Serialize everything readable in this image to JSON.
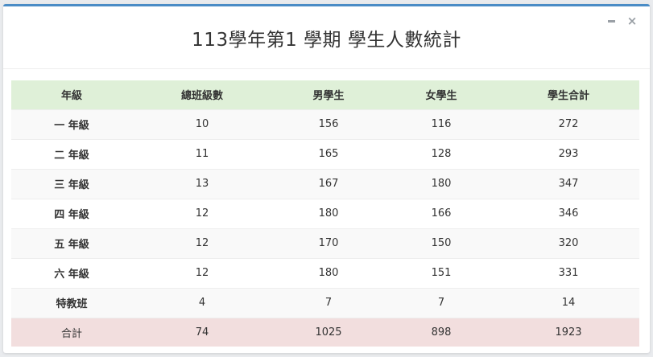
{
  "window": {
    "minimize_icon": "minimize-icon",
    "close_icon": "close-icon",
    "close_glyph": "×"
  },
  "title": "113學年第1 學期 學生人數統計",
  "colors": {
    "header_bg": "#dff0d8",
    "total_bg": "#f2dede",
    "top_border": "#4a8cc6"
  },
  "table": {
    "headers": [
      "年級",
      "總班級數",
      "男學生",
      "女學生",
      "學生合計"
    ],
    "rows": [
      {
        "label": "一 年級",
        "classes": "10",
        "boys": "156",
        "girls": "116",
        "total": "272"
      },
      {
        "label": "二 年級",
        "classes": "11",
        "boys": "165",
        "girls": "128",
        "total": "293"
      },
      {
        "label": "三 年級",
        "classes": "13",
        "boys": "167",
        "girls": "180",
        "total": "347"
      },
      {
        "label": "四 年級",
        "classes": "12",
        "boys": "180",
        "girls": "166",
        "total": "346"
      },
      {
        "label": "五 年級",
        "classes": "12",
        "boys": "170",
        "girls": "150",
        "total": "320"
      },
      {
        "label": "六 年級",
        "classes": "12",
        "boys": "180",
        "girls": "151",
        "total": "331"
      },
      {
        "label": "特教班",
        "classes": "4",
        "boys": "7",
        "girls": "7",
        "total": "14"
      }
    ],
    "total": {
      "label": "合計",
      "classes": "74",
      "boys": "1025",
      "girls": "898",
      "total": "1923"
    }
  }
}
